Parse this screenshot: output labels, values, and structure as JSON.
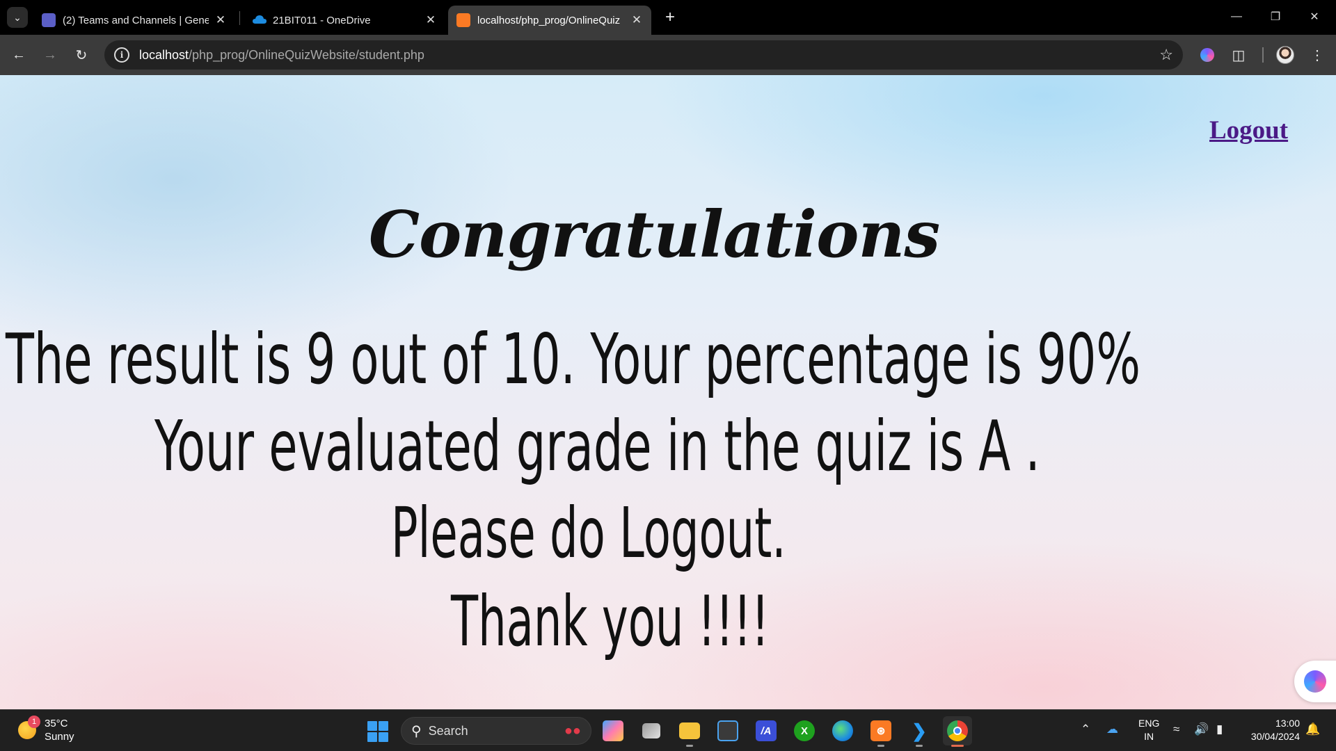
{
  "browser": {
    "tabs": [
      {
        "title": "(2) Teams and Channels | Gener",
        "favicon_color": "#5b5fc7"
      },
      {
        "title": "21BIT011 - OneDrive",
        "favicon_color": "#1d8ce0"
      },
      {
        "title": "localhost/php_prog/OnlineQuiz",
        "favicon_color": "#fb7a24",
        "active": true
      }
    ],
    "url_host": "localhost",
    "url_path": "/php_prog/OnlineQuizWebsite/student.php"
  },
  "page": {
    "logout_label": "Logout",
    "heading": "Congratulations",
    "result_line": "The result is 9 out of 10. Your percentage is 90%",
    "grade_line": "Your evaluated grade in the quiz is A .",
    "logout_prompt": "Please do Logout.",
    "thanks": "Thank you !!!!"
  },
  "taskbar": {
    "weather_temp": "35°C",
    "weather_desc": "Sunny",
    "weather_badge": "1",
    "search_label": "Search",
    "lang_line1": "ENG",
    "lang_line2": "IN",
    "time": "13:00",
    "date": "30/04/2024"
  }
}
